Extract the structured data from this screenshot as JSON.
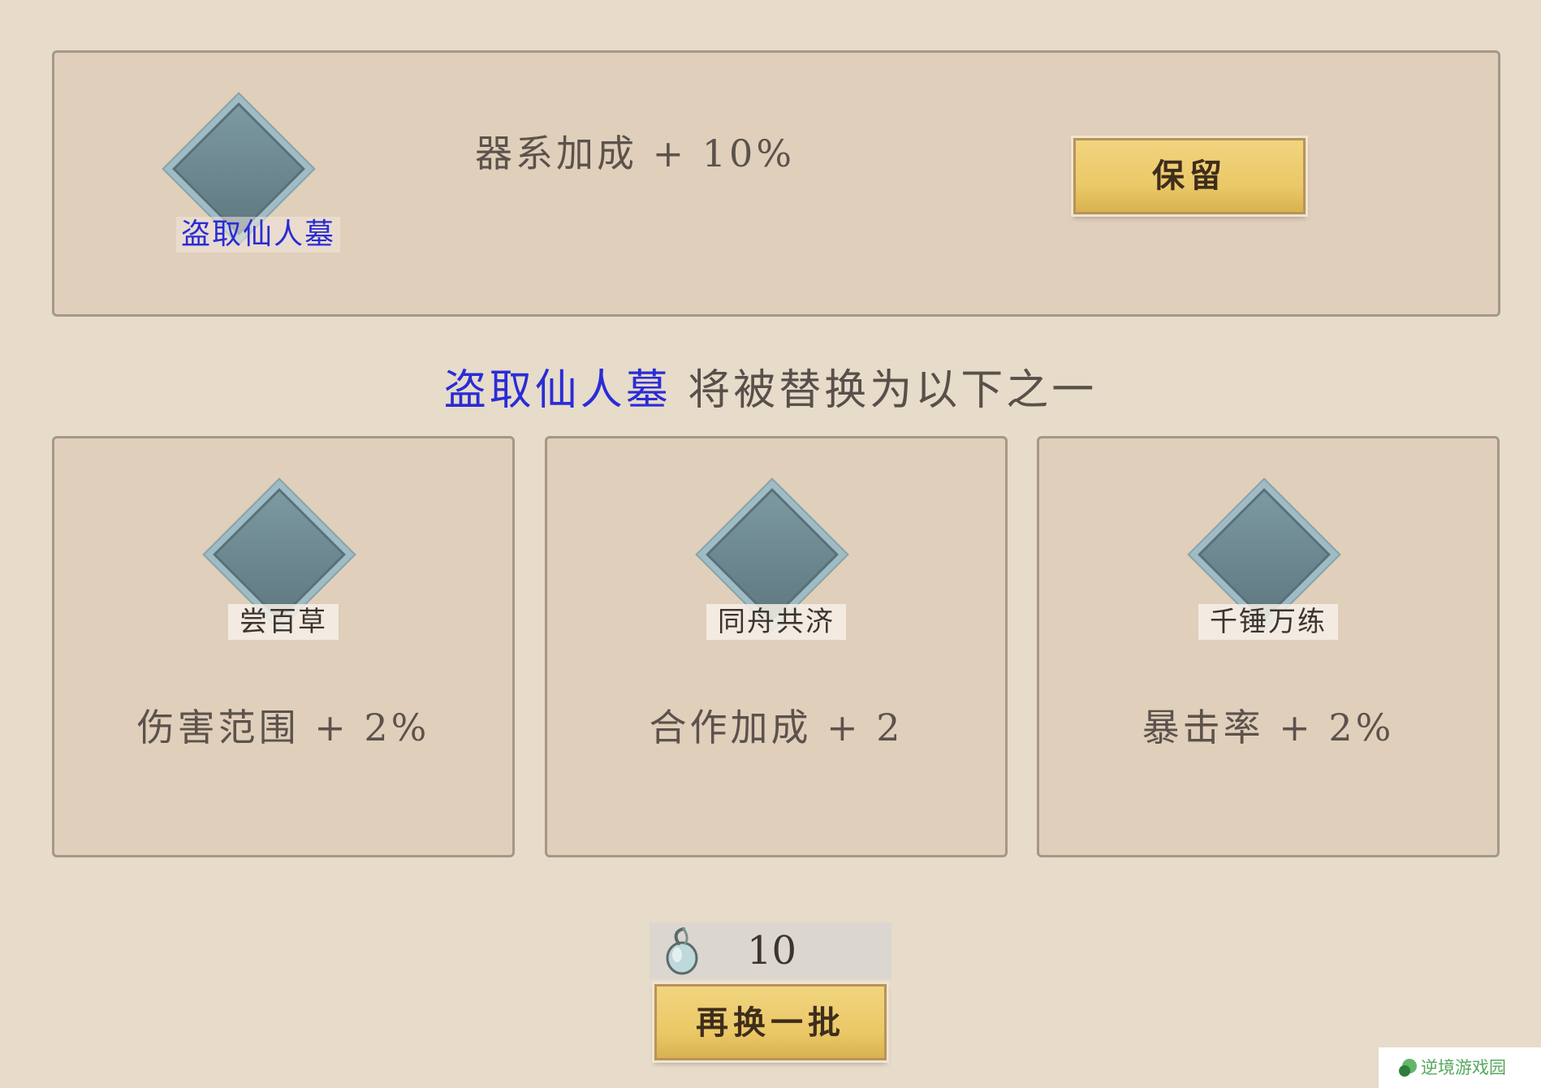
{
  "current": {
    "name": "盗取仙人墓",
    "bonus": "器系加成 + 10%",
    "keep_label": "保留"
  },
  "subtitle": {
    "highlight": "盗取仙人墓",
    "text": "将被替换为以下之一"
  },
  "choices": [
    {
      "name": "尝百草",
      "bonus": "伤害范围 + 2%"
    },
    {
      "name": "同舟共济",
      "bonus": "合作加成 + 2"
    },
    {
      "name": "千锤万练",
      "bonus": "暴击率 + 2%"
    }
  ],
  "cost": {
    "icon": "gourd-icon",
    "value": "10"
  },
  "reroll_label": "再换一批",
  "watermark": {
    "text": "逆境游戏园"
  },
  "colors": {
    "background": "#e7dbca",
    "panel": "#e0cfba",
    "highlight_blue": "#2a2cd6",
    "button_gold": "#eac866",
    "diamond": "#6a858d"
  }
}
